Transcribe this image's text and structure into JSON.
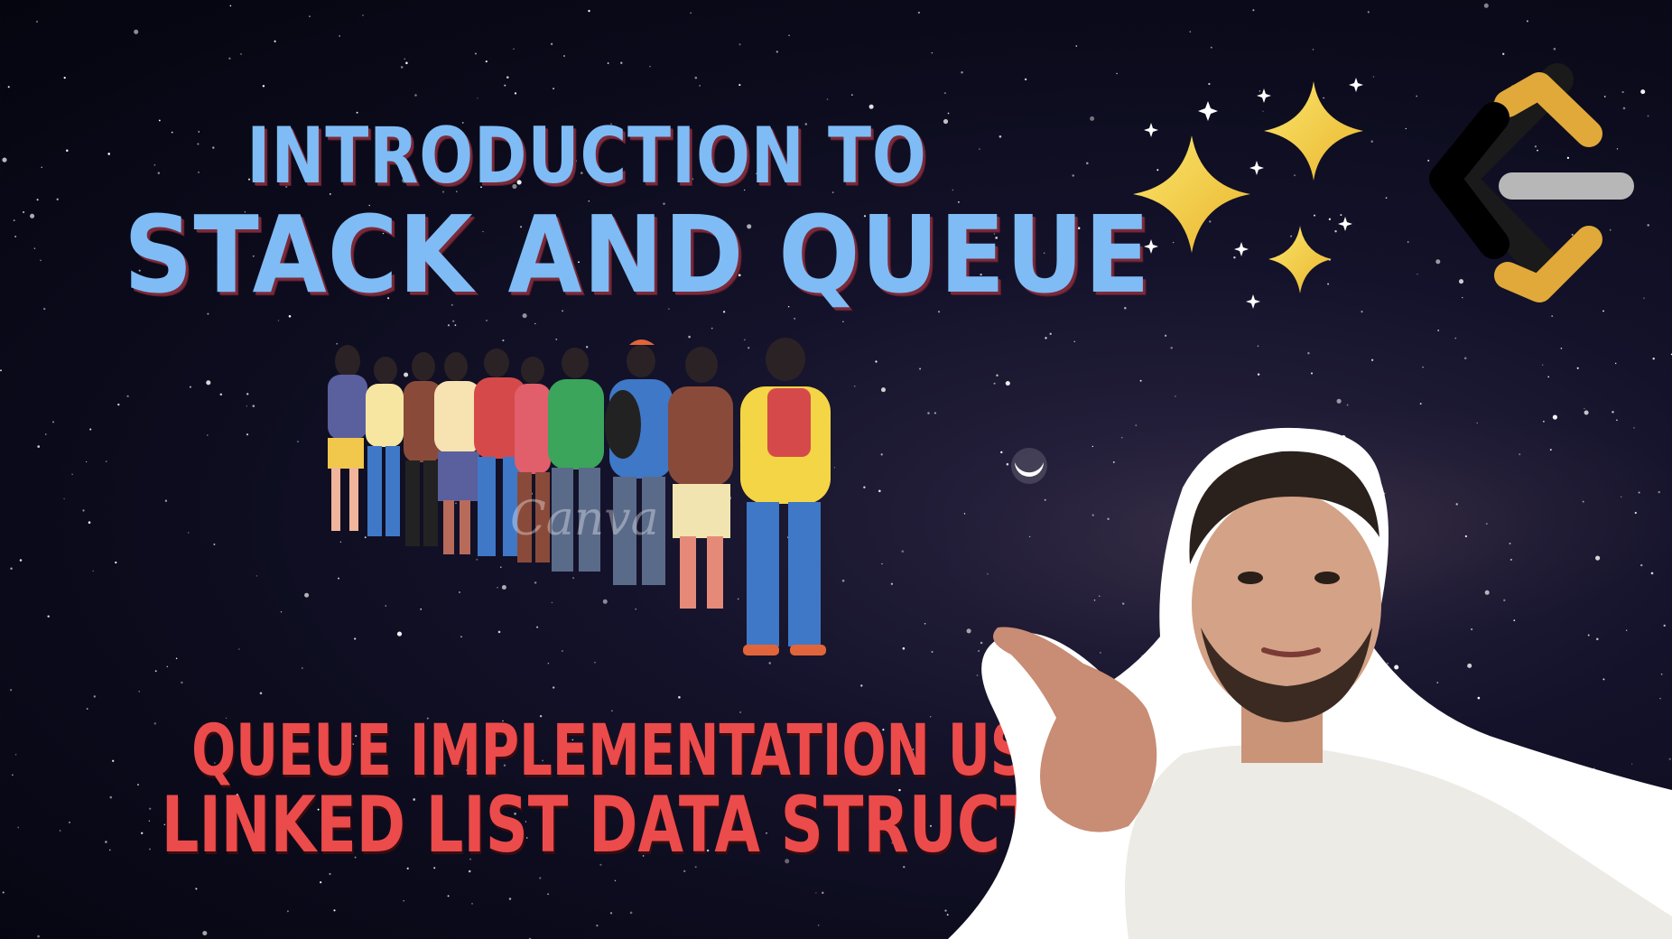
{
  "title": {
    "line1": "INTRODUCTION TO",
    "line2": "STACK AND QUEUE"
  },
  "subtitle": {
    "line1": "QUEUE IMPLEMENTATION USING",
    "line2": "LINKED LIST DATA STRUCTURE"
  },
  "watermark": "Canva",
  "icons": {
    "sparkles": "sparkles-icon",
    "logo": "leetcode-logo-icon",
    "moon": "crescent-moon-icon"
  },
  "colors": {
    "title": "#7fbcf5",
    "subtitle": "#ec4b4b",
    "sparkle": "#f5d443",
    "logo_orange": "#e0a93a",
    "logo_gray": "#b7b7b7"
  }
}
